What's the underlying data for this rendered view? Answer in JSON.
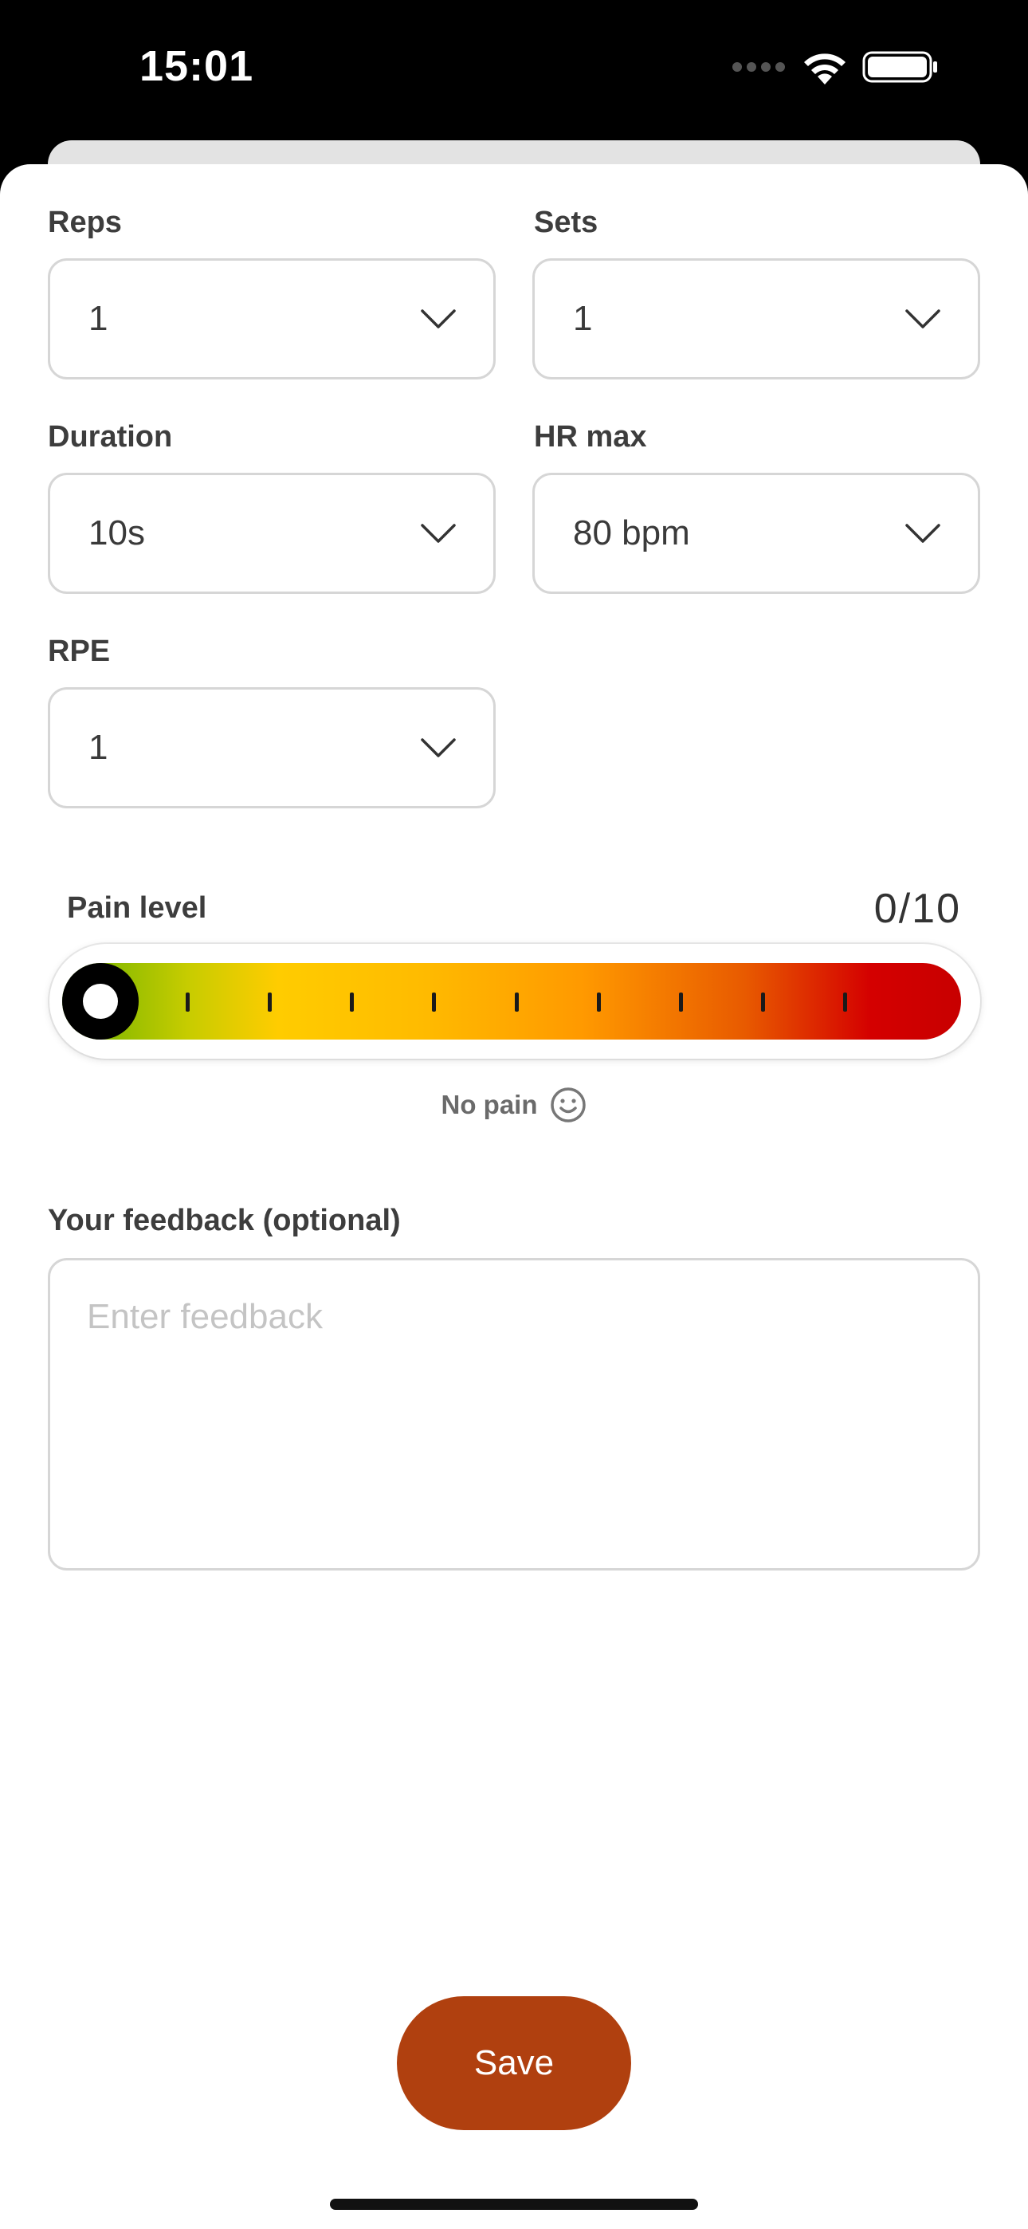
{
  "status_bar": {
    "time": "15:01"
  },
  "fields": {
    "reps": {
      "label": "Reps",
      "value": "1"
    },
    "sets": {
      "label": "Sets",
      "value": "1"
    },
    "duration": {
      "label": "Duration",
      "value": "10s"
    },
    "hr_max": {
      "label": "HR max",
      "value": "80 bpm"
    },
    "rpe": {
      "label": "RPE",
      "value": "1"
    }
  },
  "pain": {
    "label": "Pain level",
    "value_text": "0/10",
    "level": 0,
    "max": 10,
    "caption": "No pain",
    "caption_icon": "smiley-icon"
  },
  "feedback": {
    "label": "Your feedback (optional)",
    "value": "",
    "placeholder": "Enter feedback"
  },
  "actions": {
    "save_label": "Save"
  },
  "colors": {
    "save_button": "#b0400f",
    "pain_low": "#66b000",
    "pain_mid": "#ffcc00",
    "pain_high": "#c80000"
  }
}
